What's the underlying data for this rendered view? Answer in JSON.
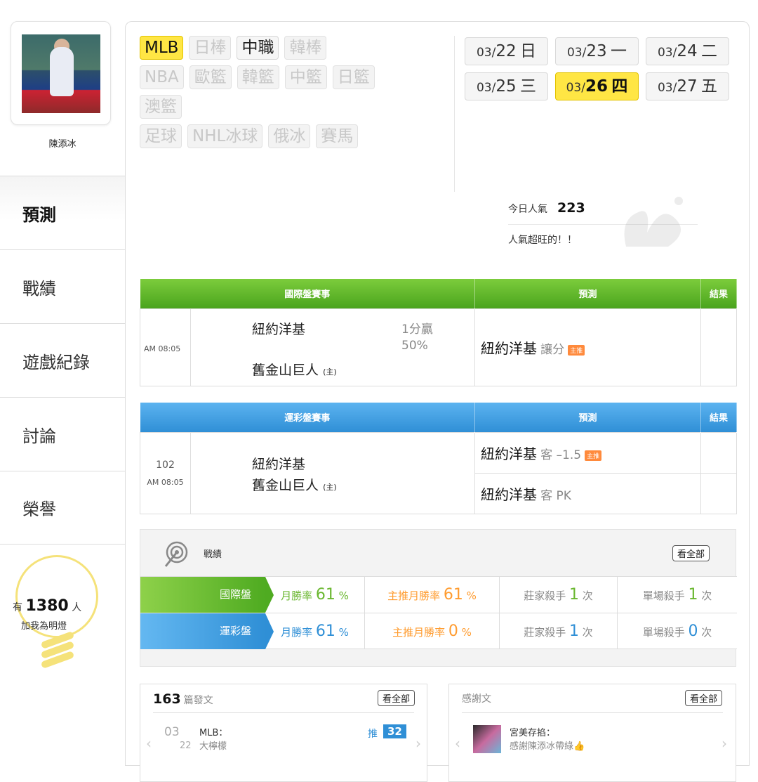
{
  "sidebar": {
    "user_name": "陳添冰",
    "nav": [
      "預測",
      "戰績",
      "遊戲紀錄",
      "討論",
      "榮譽"
    ],
    "fan_prefix": "有",
    "fan_count": "1380",
    "fan_suffix": "人",
    "fan_line2": "加我為明燈"
  },
  "sports": [
    [
      "MLB",
      "日棒",
      "中職",
      "韓棒"
    ],
    [
      "NBA",
      "歐籃",
      "韓籃",
      "中籃",
      "日籃"
    ],
    [
      "澳籃"
    ],
    [
      "足球",
      "NHL冰球",
      "俄冰",
      "賽馬"
    ]
  ],
  "dates": [
    {
      "md": "03/",
      "d": "22",
      "w": "日"
    },
    {
      "md": "03/",
      "d": "23",
      "w": "一"
    },
    {
      "md": "03/",
      "d": "24",
      "w": "二"
    },
    {
      "md": "03/",
      "d": "25",
      "w": "三"
    },
    {
      "md": "03/",
      "d": "26",
      "w": "四"
    },
    {
      "md": "03/",
      "d": "27",
      "w": "五"
    }
  ],
  "popularity": {
    "label": "今日人氣",
    "value": "223",
    "note": "人氣超旺的！！"
  },
  "intl_table": {
    "headers": [
      "國際盤賽事",
      "預測",
      "結果"
    ],
    "time": "AM 08:05",
    "team1": "紐約洋基",
    "team2": "舊金山巨人",
    "home_mark": "(主)",
    "odds_line1": "1分贏",
    "odds_line2": "50%",
    "pred_team": "紐約洋基",
    "pred_type": "讓分",
    "pred_tag": "主推"
  },
  "lottery_table": {
    "headers": [
      "運彩盤賽事",
      "預測",
      "結果"
    ],
    "game_no": "102",
    "time": "AM 08:05",
    "team1": "紐約洋基",
    "team2": "舊金山巨人",
    "home_mark": "(主)",
    "pred1_team": "紐約洋基",
    "pred1_sub": "客 –1.5",
    "pred1_tag": "主推",
    "pred2_team": "紐約洋基",
    "pred2_sub": "客 PK"
  },
  "stats": {
    "title": "戰績",
    "see_all": "看全部",
    "rows": [
      {
        "label": "國際盤",
        "win_label": "月勝率",
        "win": "61",
        "main_label": "主推月勝率",
        "main": "61",
        "killer_label": "莊家殺手",
        "killer": "1",
        "single_label": "單場殺手",
        "single": "1",
        "unit_pct": "%",
        "unit_times": "次"
      },
      {
        "label": "運彩盤",
        "win_label": "月勝率",
        "win": "61",
        "main_label": "主推月勝率",
        "main": "0",
        "killer_label": "莊家殺手",
        "killer": "1",
        "single_label": "單場殺手",
        "single": "0",
        "unit_pct": "%",
        "unit_times": "次"
      }
    ]
  },
  "posts_card": {
    "count": "163",
    "label": "篇發文",
    "see_all": "看全部",
    "item_month": "03",
    "item_day": "22",
    "item_title": "MLB：",
    "item_sub": "大檸檬",
    "push_label": "推",
    "push_count": "32"
  },
  "thanks_card": {
    "label": "感謝文",
    "see_all": "看全部",
    "item_title": "宮美存掐：",
    "item_sub": "感謝陳添冰帶綠👍"
  },
  "colors": {
    "accent_yellow": "#ffe644",
    "green": "#4aa41d",
    "blue": "#2f8fd6",
    "orange": "#ff9c30"
  }
}
